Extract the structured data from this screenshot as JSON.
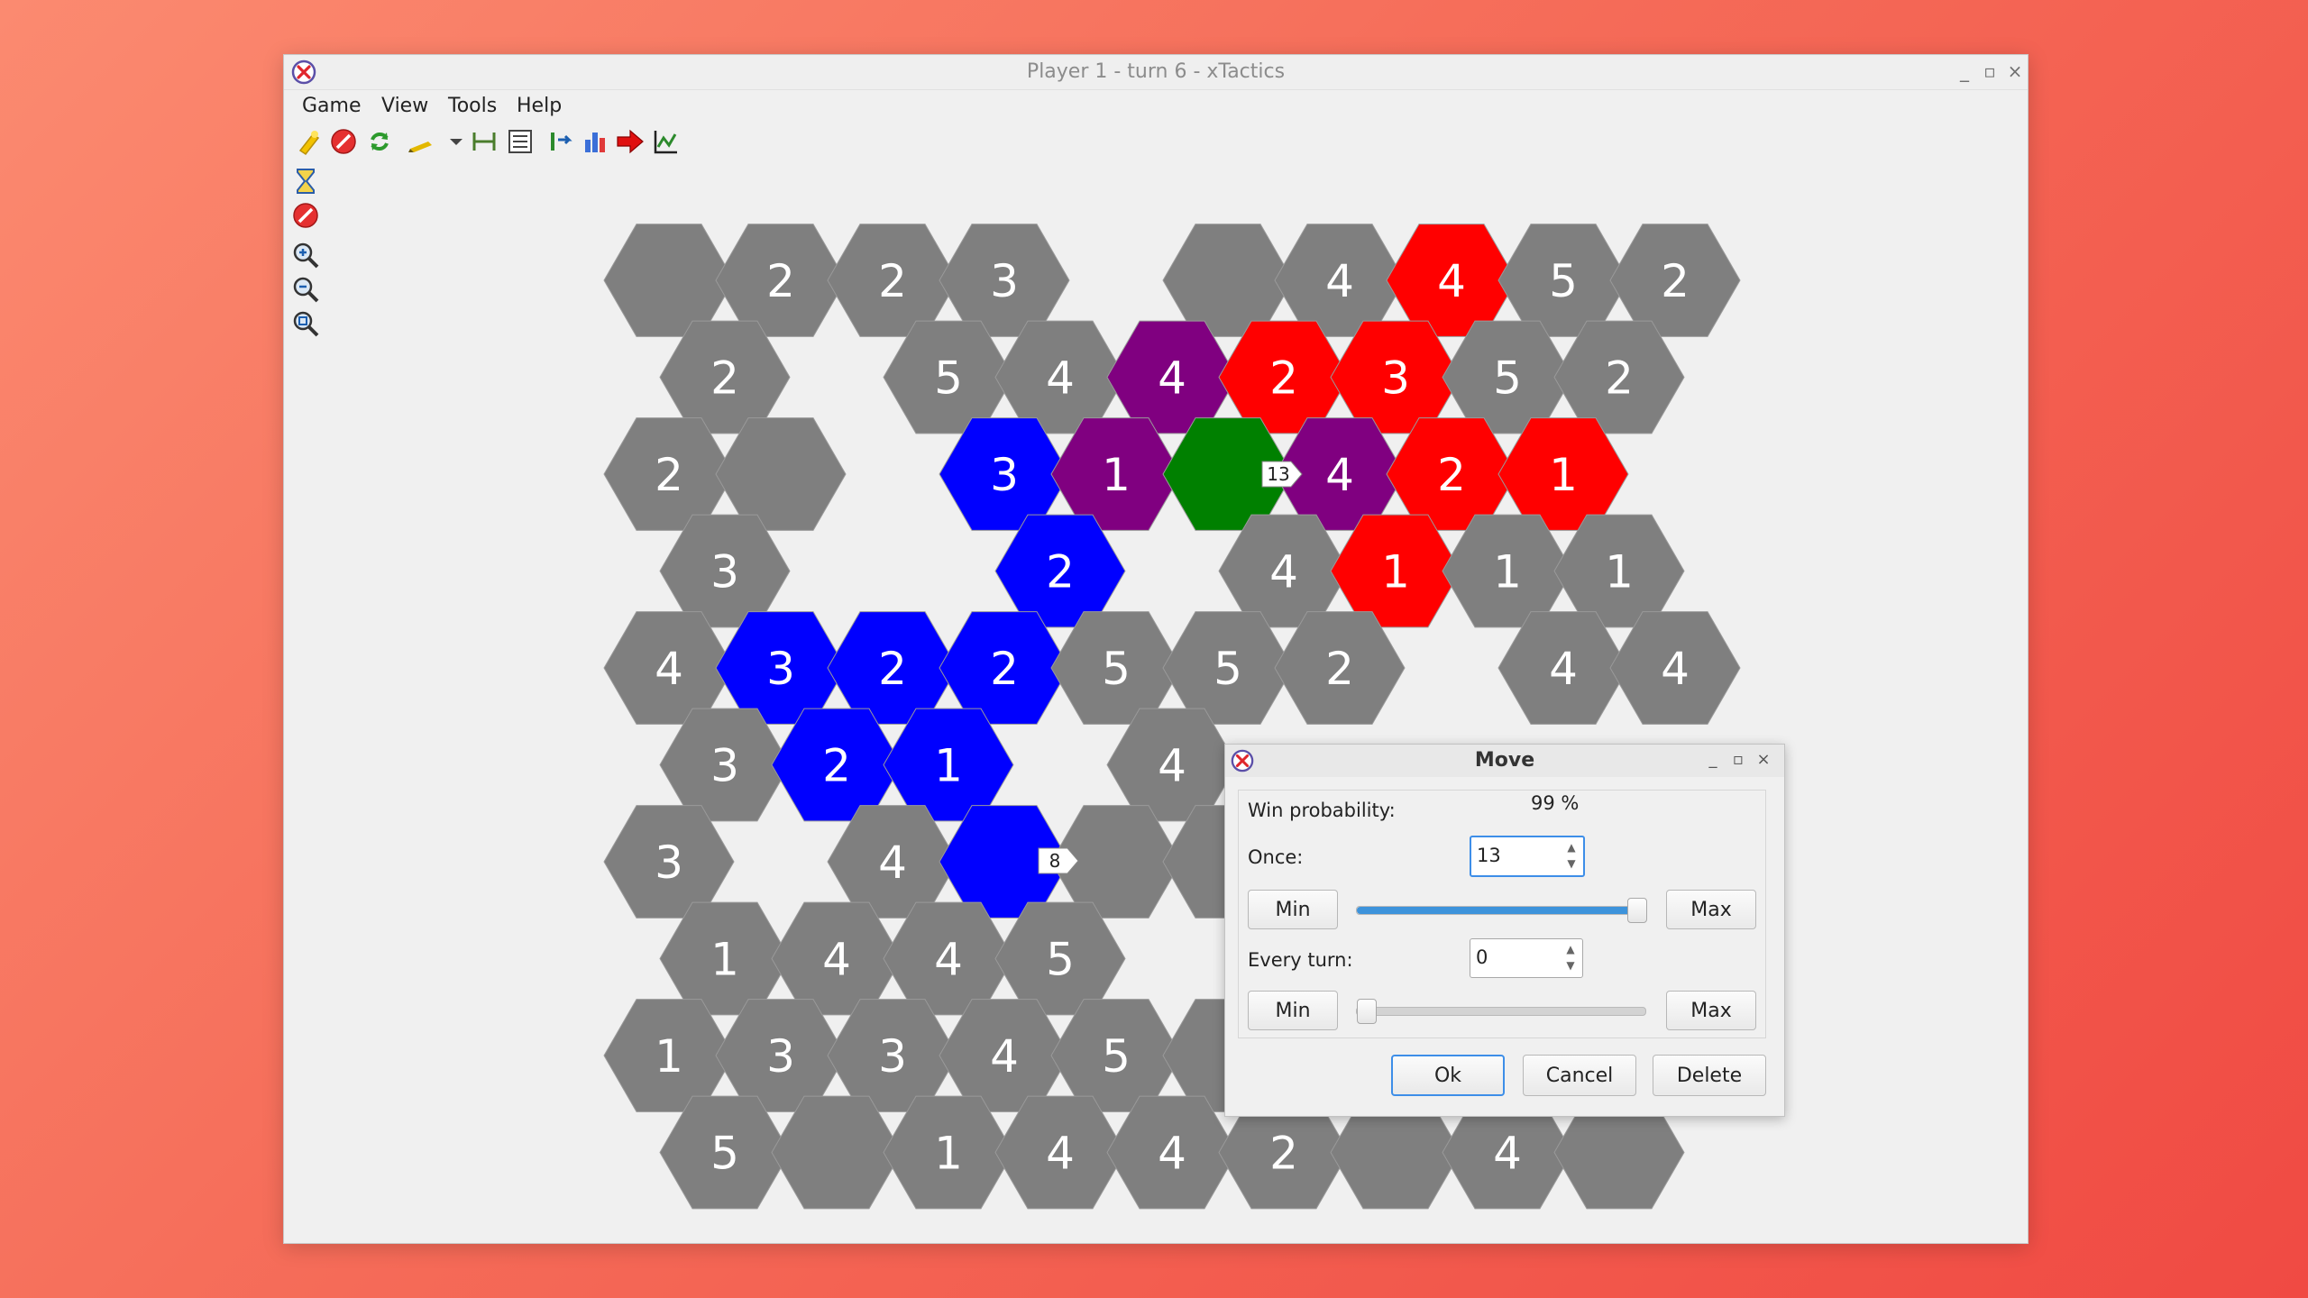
{
  "window": {
    "title": "Player 1 - turn 6 - xTactics",
    "controls": {
      "minimize": "_",
      "maximize": "▫",
      "close": "×"
    }
  },
  "menu": [
    "Game",
    "View",
    "Tools",
    "Help"
  ],
  "toolbar_icons": [
    "new-game-icon",
    "stop-icon",
    "refresh-icon",
    "edit-icon",
    "dropdown-arrow-icon",
    "fit-width-icon",
    "list-icon",
    "transfer-icon",
    "stats-chart-icon",
    "next-turn-arrow-icon",
    "run-chart-icon"
  ],
  "side_tools": [
    "hourglass-icon",
    "stop-icon",
    "zoom-in-icon",
    "zoom-out-icon",
    "zoom-fit-icon"
  ],
  "colors": {
    "neutral": "#7f7f7f",
    "blue": "#0000ff",
    "purple": "#800080",
    "green": "#008000",
    "red": "#ff0000"
  },
  "board": {
    "columns": [
      "G:·,G:2,G:2,G:3,·,G:·,G:4,R:4,G:5,G:2",
      "G:2,·,G:5,G:4,P:4,R:2,R:3,G:5,G:2",
      "G:2,G:·,B:3,P:1,N:·,P:4,R:2,R:1,·",
      "G:3,·,·,B:2,·,G:4,R:1,G:1,G:1"
    ],
    "rows": [
      [
        "G:",
        "G:2",
        "G:2",
        "G:3",
        "-",
        "G:",
        "G:4",
        "R:4",
        "G:5",
        "G:2"
      ],
      [
        "G:2",
        "-",
        "G:5",
        "G:4",
        "P:4",
        "R:2",
        "R:3",
        "G:5",
        "G:2"
      ],
      [
        "G:2",
        "G:",
        "-",
        "B:3",
        "P:1",
        "N:",
        "P:4",
        "R:2",
        "R:1",
        "-"
      ],
      [
        "G:3",
        "-",
        "-",
        "B:2",
        "-",
        "G:4",
        "R:1",
        "G:1",
        "G:1"
      ],
      [
        "G:4",
        "B:3",
        "B:2",
        "B:2",
        "G:5",
        "G:5",
        "G:2",
        "-",
        "G:4",
        "G:4"
      ],
      [
        "G:3",
        "B:2",
        "B:1",
        "-",
        "G:4",
        "-",
        "-",
        "-",
        "-"
      ],
      [
        "G:3",
        "-",
        "G:4",
        "B:",
        "G:",
        "G:",
        "-",
        "-",
        "-",
        "-"
      ],
      [
        "G:1",
        "G:4",
        "G:4",
        "G:5",
        "-",
        "-",
        "-",
        "-",
        "-"
      ],
      [
        "G:1",
        "G:3",
        "G:3",
        "G:4",
        "G:5",
        "G:",
        "-",
        "-",
        "-",
        "-"
      ],
      [
        "G:5",
        "G:",
        "G:1",
        "G:4",
        "G:4",
        "G:2",
        "G:",
        "G:4",
        "G:"
      ]
    ],
    "attack_markers": [
      {
        "label": "13"
      },
      {
        "label": "8"
      }
    ]
  },
  "dialog": {
    "title": "Move",
    "win_probability_label": "Win probability:",
    "win_probability_value": "99 %",
    "once_label": "Once:",
    "once_value": "13",
    "once_slider_fraction": 1.0,
    "every_turn_label": "Every turn:",
    "every_turn_value": "0",
    "every_turn_slider_fraction": 0.0,
    "min_label": "Min",
    "max_label": "Max",
    "ok_label": "Ok",
    "cancel_label": "Cancel",
    "delete_label": "Delete"
  }
}
